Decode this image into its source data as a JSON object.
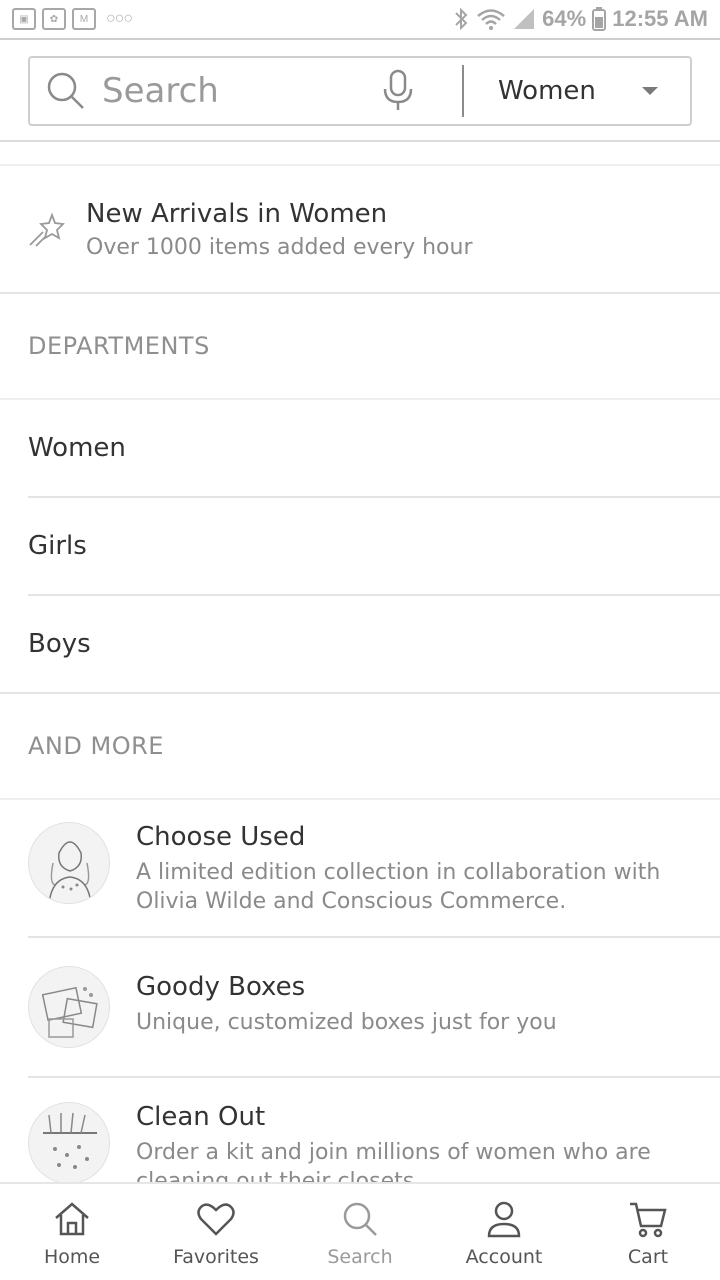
{
  "status_bar": {
    "battery": "64%",
    "time": "12:55 AM"
  },
  "search": {
    "placeholder": "Search",
    "department_selected": "Women"
  },
  "new_arrivals": {
    "title": "New Arrivals in Women",
    "subtitle": "Over 1000 items added every hour"
  },
  "departments": {
    "header": "DEPARTMENTS",
    "items": [
      "Women",
      "Girls",
      "Boys"
    ]
  },
  "more": {
    "header": "AND MORE",
    "items": [
      {
        "title": "Choose Used",
        "description": "A limited edition collection in collaboration with Olivia Wilde and Conscious Commerce."
      },
      {
        "title": "Goody Boxes",
        "description": "Unique, customized boxes just for you"
      },
      {
        "title": "Clean Out",
        "description": "Order a kit and join millions of women who are cleaning out their closets"
      }
    ]
  },
  "bottom_nav": {
    "items": [
      {
        "label": "Home",
        "icon": "home-icon"
      },
      {
        "label": "Favorites",
        "icon": "heart-icon"
      },
      {
        "label": "Search",
        "icon": "search-icon"
      },
      {
        "label": "Account",
        "icon": "person-icon"
      },
      {
        "label": "Cart",
        "icon": "cart-icon"
      }
    ]
  }
}
